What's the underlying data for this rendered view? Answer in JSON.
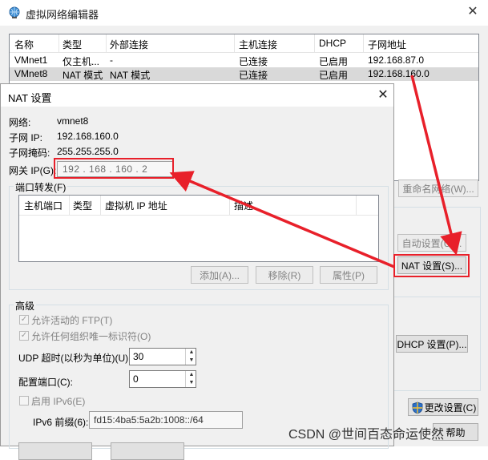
{
  "outer": {
    "title": "虚拟网络编辑器",
    "columns": [
      "名称",
      "类型",
      "外部连接",
      "主机连接",
      "DHCP",
      "子网地址"
    ],
    "rows": [
      {
        "name": "VMnet1",
        "type": "仅主机...",
        "external": "-",
        "host": "已连接",
        "dhcp": "已启用",
        "subnet": "192.168.87.0",
        "selected": false
      },
      {
        "name": "VMnet8",
        "type": "NAT 模式",
        "external": "NAT 模式",
        "host": "已连接",
        "dhcp": "已启用",
        "subnet": "192.168.160.0",
        "selected": true
      }
    ],
    "rename_button": "重命名网络(W)...",
    "auto_settings_button": "自动设置(U)...",
    "nat_settings_button": "NAT 设置(S)...",
    "dhcp_settings_button": "DHCP 设置(P)...",
    "change_settings_button": "更改设置(C)",
    "help_button": "帮助"
  },
  "nat": {
    "title": "NAT 设置",
    "network_label": "网络:",
    "network_value": "vmnet8",
    "subnet_ip_label": "子网 IP:",
    "subnet_ip_value": "192.168.160.0",
    "subnet_mask_label": "子网掩码:",
    "subnet_mask_value": "255.255.255.0",
    "gateway_label": "网关 IP(G):",
    "gateway_value": "192 . 168 . 160 .  2",
    "port_forwarding": {
      "label": "端口转发(F)",
      "columns": [
        "主机端口",
        "类型",
        "虚拟机 IP 地址",
        "描述"
      ],
      "add_button": "添加(A)...",
      "remove_button": "移除(R)",
      "properties_button": "属性(P)"
    },
    "advanced": {
      "label": "高级",
      "allow_ftp": "允许活动的 FTP(T)",
      "allow_oui": "允许任何组织唯一标识符(O)",
      "udp_timeout_label": "UDP 超时(以秒为单位)(U):",
      "udp_timeout_value": "30",
      "config_port_label": "配置端口(C):",
      "config_port_value": "0",
      "enable_ipv6": "启用 IPv6(E)",
      "ipv6_prefix_label": "IPv6 前缀(6):",
      "ipv6_prefix_value": "fd15:4ba5:5a2b:1008::/64"
    }
  },
  "watermark": "CSDN @世间百态命运使然",
  "colors": {
    "annotation_red": "#e8202a",
    "selected_row": "#d9d9d9",
    "button_face": "#e1e1e1",
    "dialog_bg": "#f0f0f0"
  }
}
